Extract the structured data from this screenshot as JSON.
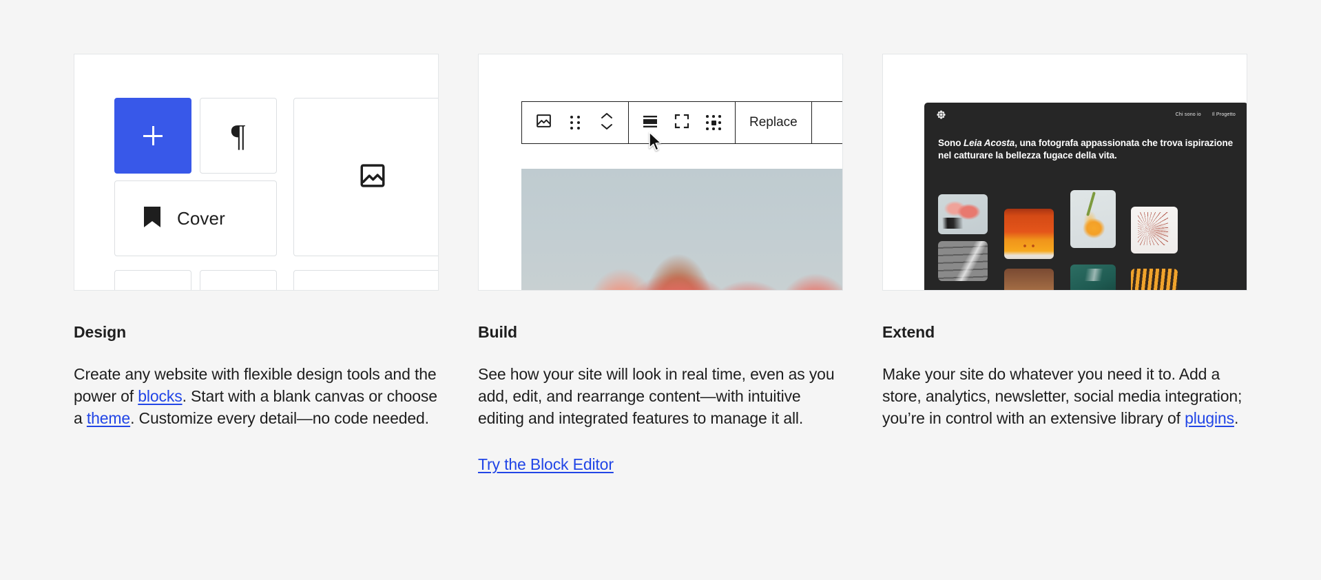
{
  "background_color": "#f5f5f5",
  "accent_color": "#3858e9",
  "link_color": "#2145e6",
  "columns": [
    {
      "id": "design",
      "heading": "Design",
      "body_parts": [
        {
          "type": "text",
          "value": "Create any website with flexible design tools and the power of "
        },
        {
          "type": "link",
          "value": "blocks"
        },
        {
          "type": "text",
          "value": ". Start with a blank canvas or choose a "
        },
        {
          "type": "link",
          "value": "theme"
        },
        {
          "type": "text",
          "value": ". Customize every detail—no code needed."
        }
      ],
      "cta": null,
      "preview": {
        "kind": "block-inserter",
        "tiles": [
          {
            "name": "add-block",
            "icon": "plus-icon",
            "label": "",
            "variant": "primary"
          },
          {
            "name": "paragraph-block",
            "icon": "pilcrow-icon",
            "label": "¶",
            "variant": "default"
          },
          {
            "name": "cover-block",
            "icon": "bookmark-icon",
            "label": "Cover",
            "variant": "default"
          },
          {
            "name": "image-block",
            "icon": "image-icon",
            "label": "",
            "variant": "default"
          }
        ]
      }
    },
    {
      "id": "build",
      "heading": "Build",
      "body_parts": [
        {
          "type": "text",
          "value": "See how your site will look in real time, even as you add, edit, and rearrange content—with intuitive editing and integrated features to manage it all."
        }
      ],
      "cta": "Try the Block Editor",
      "preview": {
        "kind": "block-toolbar",
        "toolbar": {
          "groups": [
            {
              "name": "block-type-group",
              "buttons": [
                {
                  "name": "image-block-type-button",
                  "icon": "image-icon",
                  "label": ""
                },
                {
                  "name": "drag-handle-button",
                  "icon": "drag-handle-icon",
                  "label": ""
                },
                {
                  "name": "move-updown-button",
                  "icon": "chevron-updown-icon",
                  "label": ""
                }
              ]
            },
            {
              "name": "block-format-group",
              "buttons": [
                {
                  "name": "align-button",
                  "icon": "align-icon",
                  "label": ""
                },
                {
                  "name": "crop-button",
                  "icon": "crop-icon",
                  "label": ""
                },
                {
                  "name": "more-options-button",
                  "icon": "dots-grid-icon",
                  "label": ""
                }
              ]
            },
            {
              "name": "replace-group",
              "buttons": [
                {
                  "name": "replace-button",
                  "icon": "",
                  "label": "Replace"
                }
              ]
            }
          ]
        },
        "cursor": "arrow-pointer",
        "image_alt": "pink flower petals against pale blue sky"
      }
    },
    {
      "id": "extend",
      "heading": "Extend",
      "body_parts": [
        {
          "type": "text",
          "value": "Make your site do whatever you need it to. Add a store, analytics, newsletter, social media integration; you’re in control with an extensive library of "
        },
        {
          "type": "link",
          "value": "plugins"
        },
        {
          "type": "text",
          "value": "."
        }
      ],
      "cta": null,
      "preview": {
        "kind": "site-preview",
        "site": {
          "logo": "flower-logo-icon",
          "nav_links": [
            "Chi sono io",
            "Il Progetto"
          ],
          "hero_lead": "Sono ",
          "hero_name": "Leia Acosta",
          "hero_rest": ", una fotografa appassionata che trova ispirazione nel catturare la bellezza fugace della vita.",
          "gallery_items": [
            "pink-magnolia-photo",
            "stairs-bw-photo",
            "orange-wall-photo",
            "yellow-tulip-photo",
            "dried-flower-photo",
            "brown-texture-photo",
            "teal-texture-photo",
            "amber-stripes-photo"
          ]
        }
      }
    }
  ]
}
